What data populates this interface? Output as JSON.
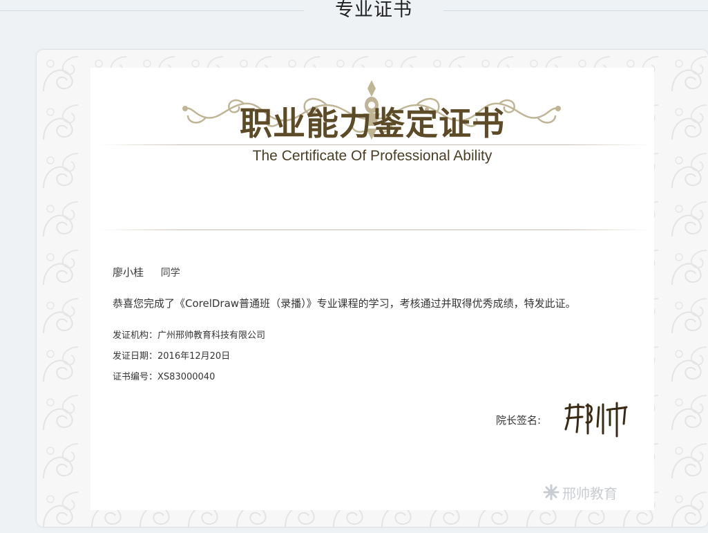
{
  "page": {
    "title": "专业证书"
  },
  "certificate": {
    "title_cn": "职业能力鉴定证书",
    "title_en": "The Certificate Of Professional Ability",
    "recipient_name": "廖小桂",
    "recipient_suffix": "同学",
    "body": "恭喜您完成了《CorelDraw普通班（录播）》专业课程的学习，考核通过并取得优秀成绩，特发此证。",
    "issuer_label": "发证机构：",
    "issuer": "广州邢帅教育科技有限公司",
    "date_label": "发证日期：",
    "date": "2016年12月20日",
    "number_label": "证书编号：",
    "number": "XS83000040",
    "signature_label": "院长签名:",
    "signature": "邢帅",
    "watermark": "邢帅教育"
  },
  "colors": {
    "title_brown": "#5d4a26",
    "ornament_gold": "#bfb595",
    "background": "#eef2f5"
  },
  "icons": {
    "watermark_logo": "asterisk-logo-icon"
  }
}
